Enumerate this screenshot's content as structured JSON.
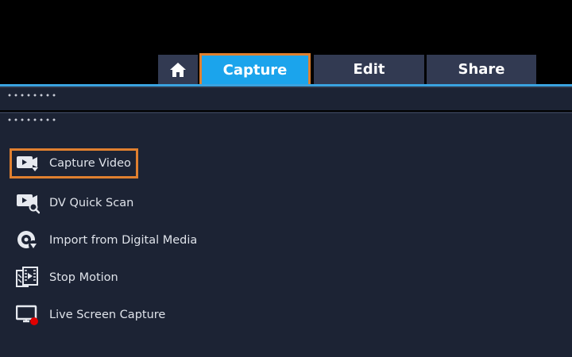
{
  "tabs": {
    "home_icon": "home-icon",
    "capture": "Capture",
    "edit": "Edit",
    "share": "Share",
    "active": "Capture"
  },
  "menu": {
    "items": [
      {
        "label": "Capture Video",
        "icon": "capture-video-icon",
        "selected": true
      },
      {
        "label": "DV Quick Scan",
        "icon": "dv-quick-scan-icon",
        "selected": false
      },
      {
        "label": "Import from Digital Media",
        "icon": "import-digital-media-icon",
        "selected": false
      },
      {
        "label": "Stop Motion",
        "icon": "stop-motion-icon",
        "selected": false
      },
      {
        "label": "Live Screen Capture",
        "icon": "live-screen-capture-icon",
        "selected": false
      }
    ]
  },
  "colors": {
    "active_tab": "#1ba4ec",
    "highlight_border": "#e0802f",
    "tab_background": "#323a52",
    "panel_background": "#1c2334",
    "accent_line": "#3aa3e0",
    "record_dot": "#e00000"
  }
}
